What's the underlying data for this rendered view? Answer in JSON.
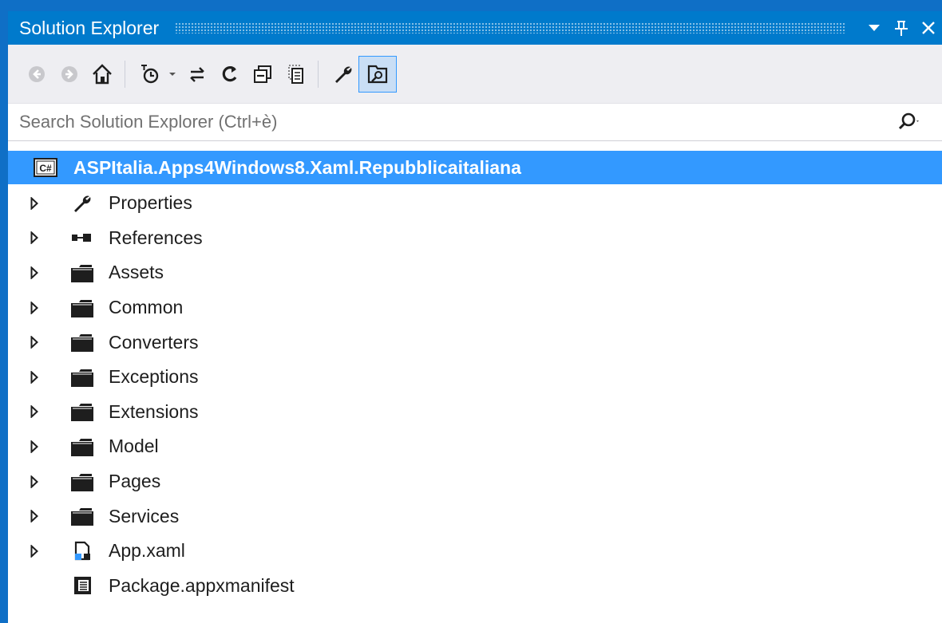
{
  "window": {
    "title": "Solution Explorer"
  },
  "search": {
    "placeholder": "Search Solution Explorer (Ctrl+è)"
  },
  "tree": {
    "project": "ASPItalia.Apps4Windows8.Xaml.Repubblicaitaliana",
    "items": [
      {
        "label": "Properties",
        "icon": "wrench-icon",
        "expandable": true
      },
      {
        "label": "References",
        "icon": "references-icon",
        "expandable": true
      },
      {
        "label": "Assets",
        "icon": "folder-icon",
        "expandable": true
      },
      {
        "label": "Common",
        "icon": "folder-icon",
        "expandable": true
      },
      {
        "label": "Converters",
        "icon": "folder-icon",
        "expandable": true
      },
      {
        "label": "Exceptions",
        "icon": "folder-icon",
        "expandable": true
      },
      {
        "label": "Extensions",
        "icon": "folder-icon",
        "expandable": true
      },
      {
        "label": "Model",
        "icon": "folder-icon",
        "expandable": true
      },
      {
        "label": "Pages",
        "icon": "folder-icon",
        "expandable": true
      },
      {
        "label": "Services",
        "icon": "folder-icon",
        "expandable": true
      },
      {
        "label": "App.xaml",
        "icon": "xaml-file-icon",
        "expandable": true
      },
      {
        "label": "Package.appxmanifest",
        "icon": "manifest-file-icon",
        "expandable": false
      }
    ]
  },
  "colors": {
    "frame": "#0f6fc6",
    "titlebar": "#007acc",
    "selection": "#3399ff",
    "toolbar": "#eeeef2"
  }
}
